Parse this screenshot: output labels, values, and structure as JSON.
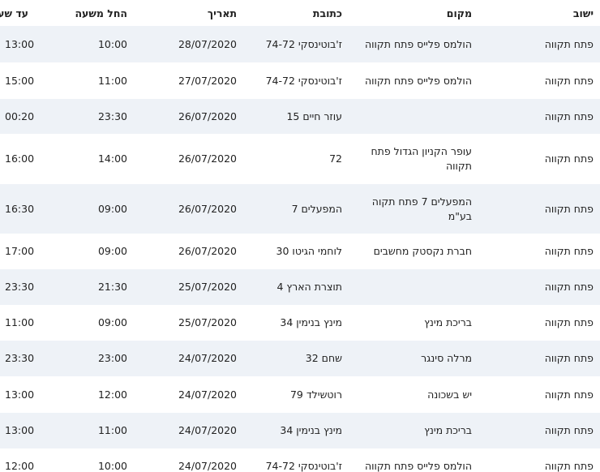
{
  "table": {
    "headers": {
      "city": "ישוב",
      "place": "מקום",
      "address": "כתובת",
      "date": "תאריך",
      "start": "החל משעה",
      "end": "עד שעה"
    },
    "rows": [
      {
        "city": "פתח תקווה",
        "place": "הולמס פלייס פתח תקווה",
        "address": "ז'בוטינסקי 74-72",
        "date": "28/07/2020",
        "start": "10:00",
        "end": "13:00"
      },
      {
        "city": "פתח תקווה",
        "place": "הולמס פלייס פתח תקווה",
        "address": "ז'בוטינסקי 74-72",
        "date": "27/07/2020",
        "start": "11:00",
        "end": "15:00"
      },
      {
        "city": "פתח תקווה",
        "place": "",
        "address": "עוזר חיים 15",
        "date": "26/07/2020",
        "start": "23:30",
        "end": "00:20"
      },
      {
        "city": "פתח תקווה",
        "place": "עופר הקניון הגדול פתח תקווה",
        "address": "72",
        "date": "26/07/2020",
        "start": "14:00",
        "end": "16:00"
      },
      {
        "city": "פתח תקווה",
        "place": "המפעלים 7 פתח תקוה בע\"מ",
        "address": "המפעלים 7",
        "date": "26/07/2020",
        "start": "09:00",
        "end": "16:30"
      },
      {
        "city": "פתח תקווה",
        "place": "חברת נקסטק מחשבים",
        "address": "לוחמי הגיטו 30",
        "date": "26/07/2020",
        "start": "09:00",
        "end": "17:00"
      },
      {
        "city": "פתח תקווה",
        "place": "",
        "address": "תוצרת הארץ 4",
        "date": "25/07/2020",
        "start": "21:30",
        "end": "23:30"
      },
      {
        "city": "פתח תקווה",
        "place": "בריכת מינץ",
        "address": "מינץ בנימין 34",
        "date": "25/07/2020",
        "start": "09:00",
        "end": "11:00"
      },
      {
        "city": "פתח תקווה",
        "place": "מרלה סינגר",
        "address": "שחם 32",
        "date": "24/07/2020",
        "start": "23:00",
        "end": "23:30"
      },
      {
        "city": "פתח תקווה",
        "place": "יש בשכונה",
        "address": "רוטשילד 79",
        "date": "24/07/2020",
        "start": "12:00",
        "end": "13:00"
      },
      {
        "city": "פתח תקווה",
        "place": "בריכת מינץ",
        "address": "מינץ בנימין 34",
        "date": "24/07/2020",
        "start": "11:00",
        "end": "13:00"
      },
      {
        "city": "פתח תקווה",
        "place": "הולמס פלייס פתח תקווה",
        "address": "ז'בוטינסקי 74-72",
        "date": "24/07/2020",
        "start": "10:00",
        "end": "12:00"
      }
    ]
  }
}
